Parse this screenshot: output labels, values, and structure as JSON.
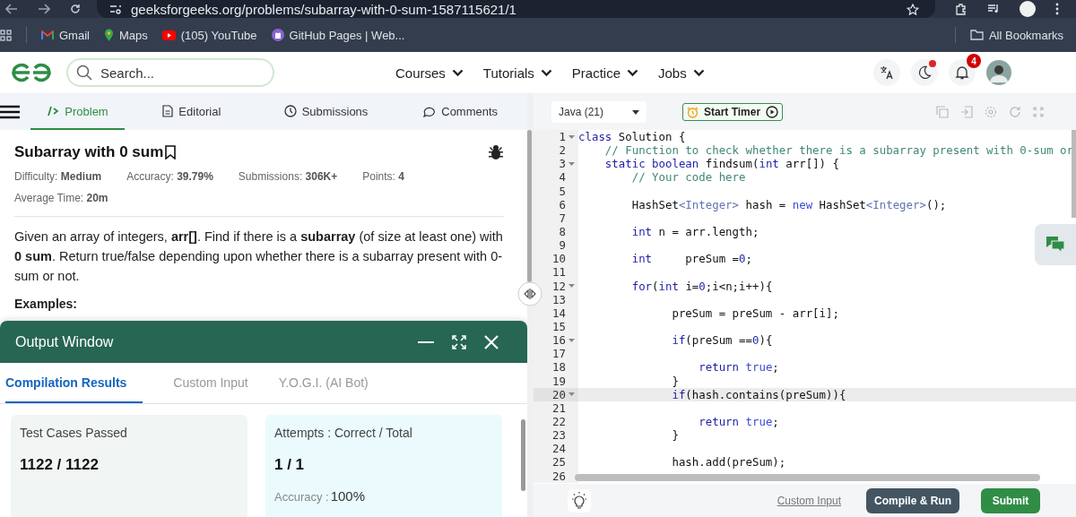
{
  "browser": {
    "url": "geeksforgeeks.org/problems/subarray-with-0-sum-1587115621/1",
    "bookmarks": [
      {
        "label": "Gmail",
        "kind": "mail"
      },
      {
        "label": "Maps",
        "kind": "maps"
      },
      {
        "label": "(105) YouTube",
        "kind": "video"
      },
      {
        "label": "GitHub Pages | Web...",
        "kind": "cat"
      }
    ],
    "all_bookmarks": "All Bookmarks"
  },
  "header": {
    "search_placeholder": "Search...",
    "nav": [
      "Courses",
      "Tutorials",
      "Practice",
      "Jobs"
    ],
    "notification_count": "4"
  },
  "problem_tabs": [
    {
      "label": "Problem",
      "kind": "code",
      "selected": true
    },
    {
      "label": "Editorial",
      "kind": "doc",
      "selected": false
    },
    {
      "label": "Submissions",
      "kind": "clock",
      "selected": false
    },
    {
      "label": "Comments",
      "kind": "chat",
      "selected": false
    }
  ],
  "problem": {
    "title": "Subarray with 0 sum",
    "meta_rows": [
      [
        {
          "label": "Difficulty: ",
          "value": "Medium"
        },
        {
          "label": "Accuracy: ",
          "value": "39.79%"
        },
        {
          "label": "Submissions: ",
          "value": "306K+"
        },
        {
          "label": "Points: ",
          "value": "4"
        }
      ],
      [
        {
          "label": "Average Time: ",
          "value": "20m"
        }
      ]
    ],
    "description": "Given an array of integers, **arr[]**. Find if there is a **subarray** (of size at least one) with **0 sum**. Return true/false depending upon whether there is a subarray present with 0-sum or not.",
    "examples_heading": "Examples:"
  },
  "output_window": {
    "title": "Output Window",
    "tabs": [
      {
        "label": "Compilation Results",
        "selected": true
      },
      {
        "label": "Custom Input",
        "selected": false
      },
      {
        "label": "Y.O.G.I. (AI Bot)",
        "selected": false
      }
    ],
    "cards": [
      {
        "kind": "tests",
        "title": "Test Cases Passed",
        "value": "1122 / 1122"
      },
      {
        "kind": "attempts",
        "title": "Attempts : Correct / Total",
        "value": "1 / 1",
        "accuracy_label": "Accuracy : ",
        "accuracy_value": "100%"
      }
    ]
  },
  "editor": {
    "language": "Java (21)",
    "timer": "Start Timer",
    "lines": [
      {
        "number": "1",
        "fold": true,
        "highlighted": false,
        "tokens": [
          {
            "kind": "kw",
            "text": "class"
          },
          {
            "kind": "tx",
            "text": " Solution {"
          }
        ]
      },
      {
        "number": "2",
        "fold": false,
        "highlighted": false,
        "tokens": [
          {
            "kind": "cm",
            "text": "    // Function to check whether there is a subarray present with 0-sum or"
          }
        ]
      },
      {
        "number": "3",
        "fold": true,
        "highlighted": false,
        "tokens": [
          {
            "kind": "kw",
            "text": "    static"
          },
          {
            "kind": "kw",
            "text": " boolean"
          },
          {
            "kind": "tx",
            "text": " findsum("
          },
          {
            "kind": "kw",
            "text": "int"
          },
          {
            "kind": "tx",
            "text": " arr[]) {"
          }
        ]
      },
      {
        "number": "4",
        "fold": false,
        "highlighted": false,
        "tokens": [
          {
            "kind": "cm",
            "text": "        // Your code here"
          }
        ]
      },
      {
        "number": "5",
        "fold": false,
        "highlighted": false
      },
      {
        "number": "6",
        "fold": false,
        "highlighted": false,
        "tokens": [
          {
            "kind": "tx",
            "text": "        HashSet"
          },
          {
            "kind": "ty",
            "text": "<Integer>"
          },
          {
            "kind": "tx",
            "text": " hash = "
          },
          {
            "kind": "lit",
            "text": "new"
          },
          {
            "kind": "tx",
            "text": " HashSet"
          },
          {
            "kind": "ty",
            "text": "<Integer>"
          },
          {
            "kind": "tx",
            "text": "();"
          }
        ]
      },
      {
        "number": "7",
        "fold": false,
        "highlighted": false
      },
      {
        "number": "8",
        "fold": false,
        "highlighted": false,
        "tokens": [
          {
            "kind": "kw",
            "text": "        int"
          },
          {
            "kind": "tx",
            "text": " n = arr.length;"
          }
        ]
      },
      {
        "number": "9",
        "fold": false,
        "highlighted": false
      },
      {
        "number": "10",
        "fold": false,
        "highlighted": false,
        "tokens": [
          {
            "kind": "kw",
            "text": "        int"
          },
          {
            "kind": "tx",
            "text": "     preSum ="
          },
          {
            "kind": "num",
            "text": "0"
          },
          {
            "kind": "tx",
            "text": ";"
          }
        ]
      },
      {
        "number": "11",
        "fold": false,
        "highlighted": false
      },
      {
        "number": "12",
        "fold": true,
        "highlighted": false,
        "tokens": [
          {
            "kind": "kw",
            "text": "        for"
          },
          {
            "kind": "tx",
            "text": "("
          },
          {
            "kind": "kw",
            "text": "int"
          },
          {
            "kind": "tx",
            "text": " i="
          },
          {
            "kind": "num",
            "text": "0"
          },
          {
            "kind": "tx",
            "text": ";i<n;i++){"
          }
        ]
      },
      {
        "number": "13",
        "fold": false,
        "highlighted": false
      },
      {
        "number": "14",
        "fold": false,
        "highlighted": false,
        "tokens": [
          {
            "kind": "tx",
            "text": "              preSum = preSum - arr[i];"
          }
        ]
      },
      {
        "number": "15",
        "fold": false,
        "highlighted": false
      },
      {
        "number": "16",
        "fold": true,
        "highlighted": false,
        "tokens": [
          {
            "kind": "kw",
            "text": "              if"
          },
          {
            "kind": "tx",
            "text": "(preSum =="
          },
          {
            "kind": "num",
            "text": "0"
          },
          {
            "kind": "tx",
            "text": "){"
          }
        ]
      },
      {
        "number": "17",
        "fold": false,
        "highlighted": false
      },
      {
        "number": "18",
        "fold": false,
        "highlighted": false,
        "tokens": [
          {
            "kind": "kw",
            "text": "                  return"
          },
          {
            "kind": "lit",
            "text": " true"
          },
          {
            "kind": "tx",
            "text": ";"
          }
        ]
      },
      {
        "number": "19",
        "fold": false,
        "highlighted": false,
        "tokens": [
          {
            "kind": "tx",
            "text": "              }"
          }
        ]
      },
      {
        "number": "20",
        "fold": true,
        "highlighted": true,
        "tokens": [
          {
            "kind": "kw",
            "text": "              if"
          },
          {
            "kind": "tx",
            "text": "(hash.contains(preSum)){"
          }
        ]
      },
      {
        "number": "21",
        "fold": false,
        "highlighted": false
      },
      {
        "number": "22",
        "fold": false,
        "highlighted": false,
        "tokens": [
          {
            "kind": "kw",
            "text": "                  return"
          },
          {
            "kind": "lit",
            "text": " true"
          },
          {
            "kind": "tx",
            "text": ";"
          }
        ]
      },
      {
        "number": "23",
        "fold": false,
        "highlighted": false,
        "tokens": [
          {
            "kind": "tx",
            "text": "              }"
          }
        ]
      },
      {
        "number": "24",
        "fold": false,
        "highlighted": false
      },
      {
        "number": "25",
        "fold": false,
        "highlighted": false,
        "tokens": [
          {
            "kind": "tx",
            "text": "              hash.add(preSum);"
          }
        ]
      },
      {
        "number": "26",
        "fold": false,
        "highlighted": false
      }
    ]
  },
  "footer": {
    "custom_input": "Custom Input",
    "compile": "Compile & Run",
    "submit": "Submit"
  }
}
